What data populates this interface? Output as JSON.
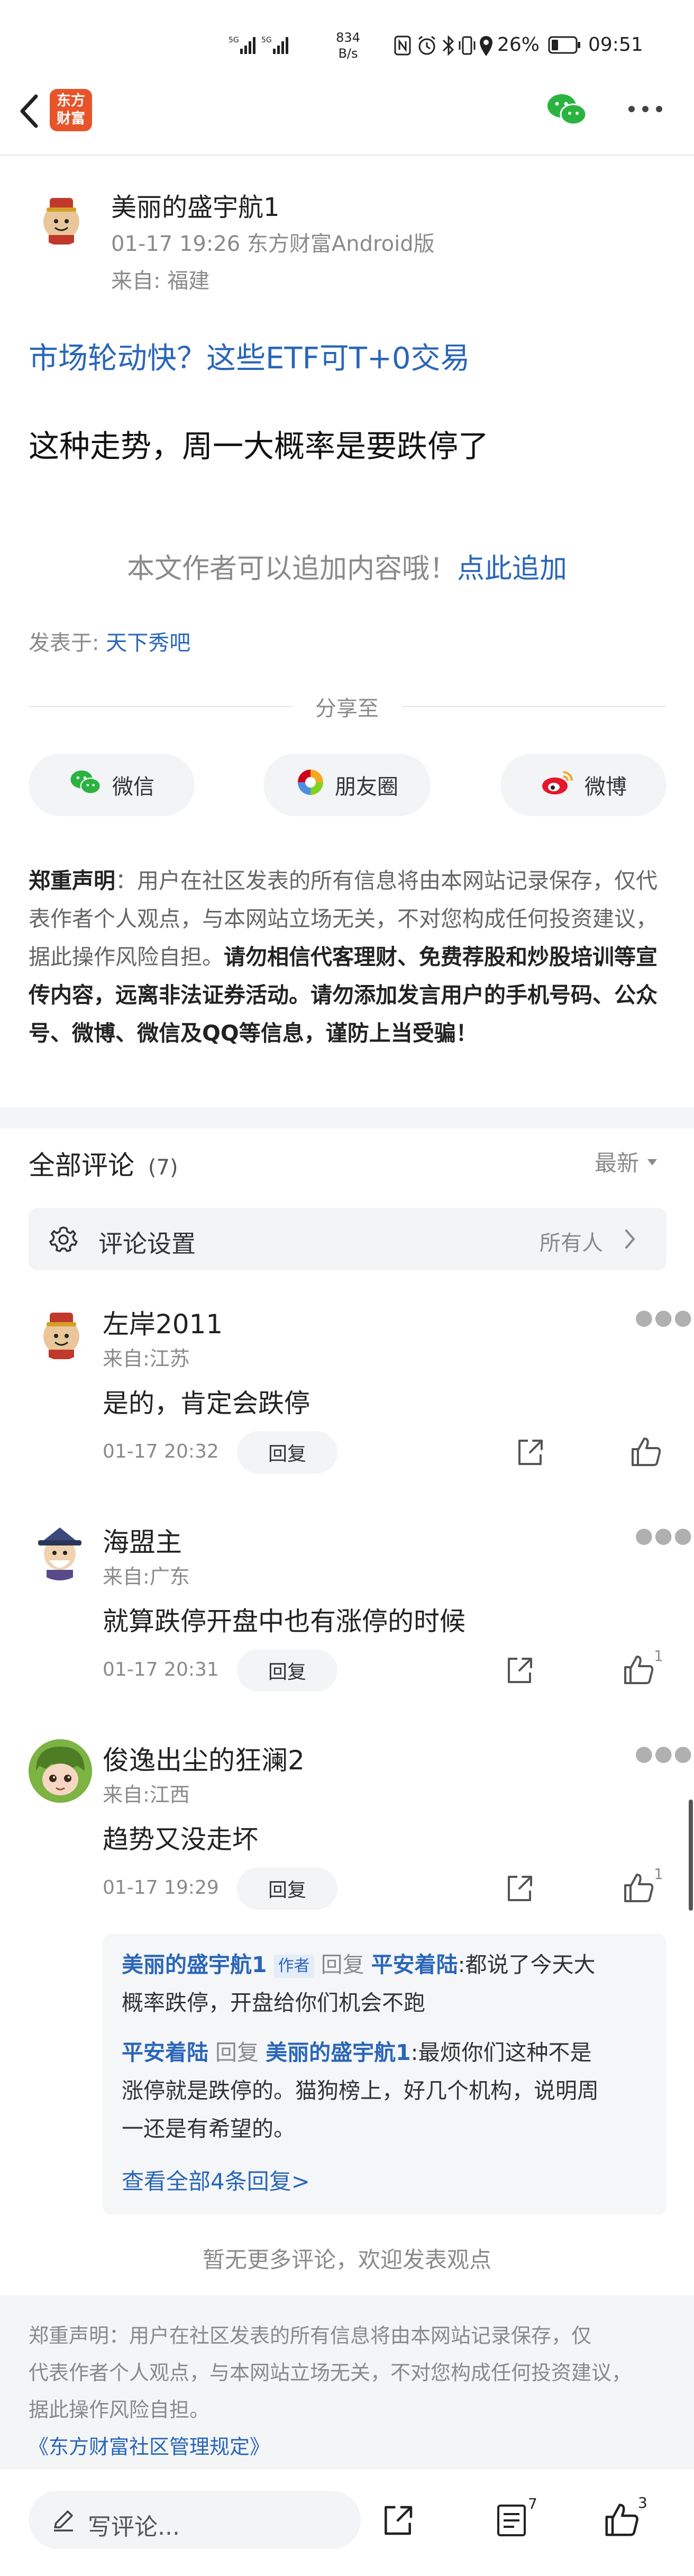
{
  "status_bar": {
    "speed_value": "834",
    "speed_unit": "B/s",
    "battery": "26%",
    "time": "09:51"
  },
  "header": {
    "logo_line1": "东方",
    "logo_line2": "财富"
  },
  "post": {
    "author": "美丽的盛宇航1",
    "meta": "01-17 19:26 东方财富Android版",
    "from": "来自: 福建",
    "ad_link": "市场轮动快？这些ETF可T+0交易",
    "body": "这种走势，周一大概率是要跌停了",
    "append_hint": "本文作者可以追加内容哦！",
    "append_link": "点此追加",
    "posted_in_label": "发表于:",
    "posted_in_bar": "天下秀吧"
  },
  "share": {
    "title": "分享至",
    "wechat": "微信",
    "moments": "朋友圈",
    "weibo": "微博"
  },
  "disclaimer": {
    "label": "郑重声明",
    "text_normal": "：用户在社区发表的所有信息将由本网站记录保存，仅代表作者个人观点，与本网站立场无关，不对您构成任何投资建议，据此操作风险自担。",
    "text_bold": "请勿相信代客理财、免费荐股和炒股培训等宣传内容，远离非法证券活动。请勿添加发言用户的手机号码、公众号、微博、微信及QQ等信息，谨防上当受骗！"
  },
  "comments_header": {
    "title": "全部评论",
    "count": "(7)",
    "sort": "最新"
  },
  "comment_settings": {
    "label": "评论设置",
    "value": "所有人"
  },
  "comments": [
    {
      "name": "左岸2011",
      "from": "来自:江苏",
      "body": "是的，肯定会跌停",
      "time": "01-17 20:32",
      "reply": "回复",
      "likes": ""
    },
    {
      "name": "海盟主",
      "from": "来自:广东",
      "body": "就算跌停开盘中也有涨停的时候",
      "time": "01-17 20:31",
      "reply": "回复",
      "likes": "1"
    },
    {
      "name": "俊逸出尘的狂澜2",
      "from": "来自:江西",
      "body": "趋势又没走坏",
      "time": "01-17 19:29",
      "reply": "回复",
      "likes": "1"
    }
  ],
  "sub_replies": {
    "r1_name": "美丽的盛宇航1",
    "r1_tag": "作者",
    "r1_reply_word": "回复",
    "r1_target": "平安着陆",
    "r1_text_a": ":都说了今天大",
    "r1_text_b": "概率跌停，开盘给你们机会不跑",
    "r2_name": "平安着陆",
    "r2_reply_word": "回复",
    "r2_target": "美丽的盛宇航1",
    "r2_text_a": ":最烦你们这种不是",
    "r2_text_b": "涨停就是跌停的。猫狗榜上，好几个机构，说明周",
    "r2_text_c": "一还是有希望的。",
    "view_all": "查看全部4条回复>"
  },
  "no_more": "暂无更多评论，欢迎发表观点",
  "footer_disclaimer": {
    "line1": "郑重声明：用户在社区发表的所有信息将由本网站记录保存，仅",
    "line2": "代表作者个人观点，与本网站立场无关，不对您构成任何投资建议，",
    "line3": "据此操作风险自担。",
    "rules_link": "《东方财富社区管理规定》"
  },
  "bottom_bar": {
    "comment_placeholder": "写评论...",
    "comment_count": "7",
    "like_count": "3"
  },
  "colors": {
    "brand": "#e8542a",
    "link": "#2a66b8",
    "wechat_green": "#2bb340"
  }
}
